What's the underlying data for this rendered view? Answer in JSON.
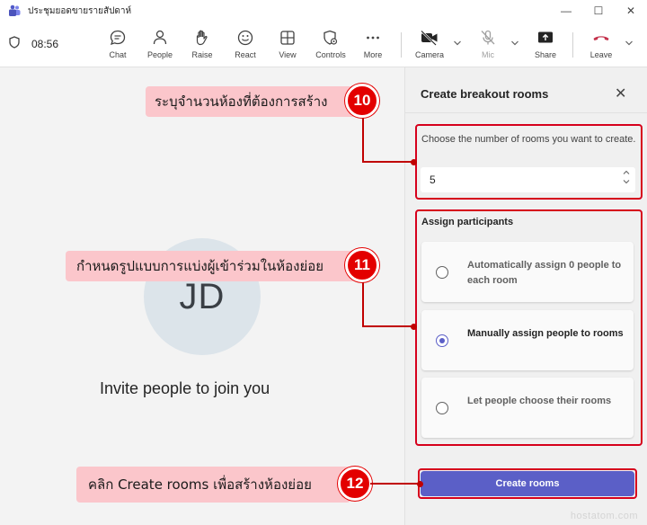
{
  "window": {
    "title": "ประชุมยอดขายรายสัปดาห์",
    "controls": {
      "minimize": "—",
      "maximize": "☐",
      "close": "✕"
    }
  },
  "toolbar": {
    "timer": "08:56",
    "buttons": [
      {
        "label": "Chat",
        "icon": "chat-icon"
      },
      {
        "label": "People",
        "icon": "people-icon"
      },
      {
        "label": "Raise",
        "icon": "hand-icon"
      },
      {
        "label": "React",
        "icon": "smile-icon"
      },
      {
        "label": "View",
        "icon": "view-grid-icon"
      },
      {
        "label": "Controls",
        "icon": "shield-gear-icon"
      },
      {
        "label": "More",
        "icon": "more-dots-icon"
      },
      {
        "label": "Camera",
        "icon": "camera-off-icon"
      },
      {
        "label": "Mic",
        "icon": "mic-off-icon"
      },
      {
        "label": "Share",
        "icon": "share-icon"
      },
      {
        "label": "Leave",
        "icon": "phone-hangup-icon"
      }
    ]
  },
  "stage": {
    "avatar_initials": "JD",
    "invite_text": "Invite people to join you"
  },
  "panel": {
    "title": "Create breakout rooms",
    "close_glyph": "✕",
    "rooms_label": "Choose the number of rooms you want to create.",
    "rooms_value": "5",
    "assign_label": "Assign participants",
    "options": [
      {
        "label": "Automatically assign 0 people to each room",
        "selected": false
      },
      {
        "label": "Manually assign people to rooms",
        "selected": true
      },
      {
        "label": "Let people choose their rooms",
        "selected": false
      }
    ],
    "create_button": "Create rooms"
  },
  "annotations": [
    {
      "number": "10",
      "text": "ระบุจำนวนห้องที่ต้องการสร้าง"
    },
    {
      "number": "11",
      "text": "กำหนดรูปแบบการแบ่งผู้เข้าร่วมในห้องย่อย"
    },
    {
      "number": "12",
      "text": "คลิก Create rooms เพื่อสร้างห้องย่อย"
    }
  ],
  "watermark": "hostatom.com",
  "colors": {
    "accent": "#5b5fc7",
    "annotation_red": "#e30000",
    "callout_pink": "#fbc6cb",
    "leave_red": "#c4314b"
  }
}
